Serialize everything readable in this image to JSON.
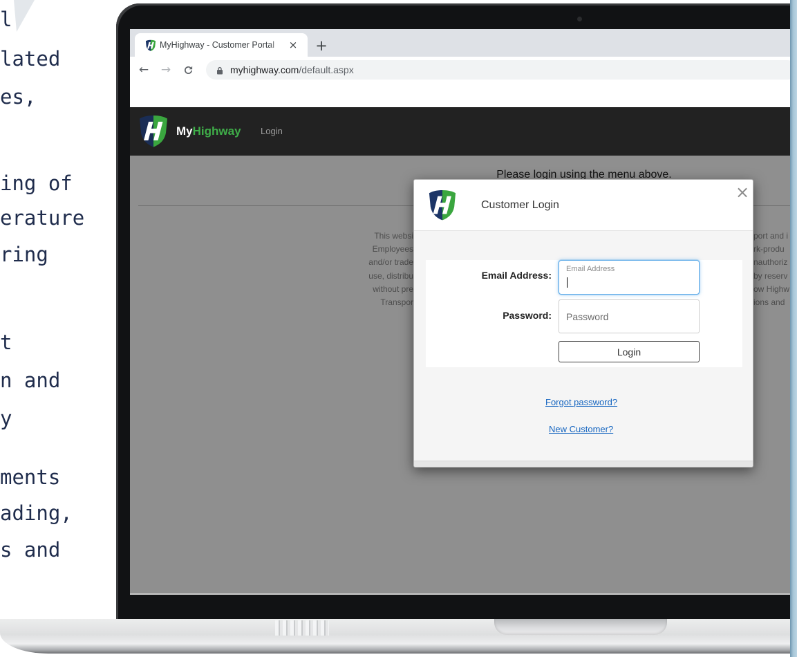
{
  "left_text": {
    "lines": [
      "l",
      "lated",
      "es,",
      "ing of",
      "erature",
      "ring",
      "t",
      "n and",
      "y",
      "ments",
      "ading,",
      "s and"
    ]
  },
  "browser": {
    "tab": {
      "title": "MyHighway - Customer Portal",
      "close": "×"
    },
    "new_tab": "+",
    "nav": {
      "back": "←",
      "forward": "→"
    },
    "url": {
      "host": "myhighway.com",
      "path": "/default.aspx"
    }
  },
  "navbar": {
    "brand_my": "My",
    "brand_highway": "Highway",
    "login": "Login"
  },
  "page": {
    "notice": "Please login using the menu above.",
    "footer_left": [
      "This websi",
      "Employees",
      "and/or trade",
      "use, distribu",
      "without pre",
      "Transpor"
    ],
    "footer_right": [
      "port and i",
      "rk-produ",
      "nauthoriz",
      "by reserv",
      "ow Highw",
      "ions and"
    ]
  },
  "modal": {
    "title": "Customer Login",
    "close": "×",
    "email_label": "Email Address:",
    "email_floating_label": "Email Address",
    "email_value": "",
    "password_label": "Password:",
    "password_placeholder": "Password",
    "password_value": "",
    "login_button": "Login",
    "forgot_link": "Forgot password?",
    "new_customer_link": "New Customer?"
  },
  "icons": {
    "favicon": "myhighway-shield",
    "brand_logo": "myhighway-shield",
    "lock": "lock",
    "reload": "reload",
    "close": "close"
  },
  "colors": {
    "navbar_bg": "#222222",
    "brand_green": "#3fae49",
    "shield_navy": "#1c3567",
    "link": "#1565c0",
    "focus_border": "#66afe9",
    "page_backdrop": "#8f8f8f",
    "side_text": "#1f2c4c",
    "accent_strip": "#a7c6d8"
  }
}
